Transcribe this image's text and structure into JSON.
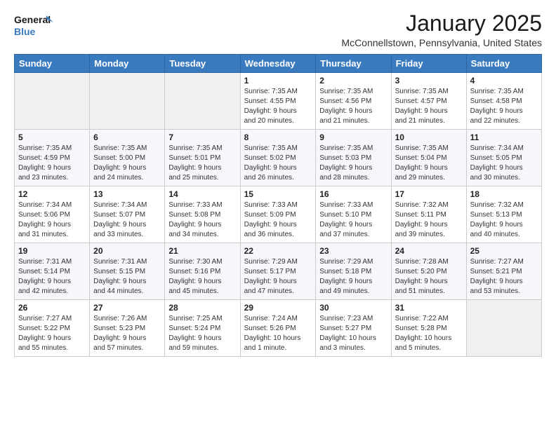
{
  "logo": {
    "line1": "General",
    "line2": "Blue"
  },
  "title": "January 2025",
  "location": "McConnellstown, Pennsylvania, United States",
  "headers": [
    "Sunday",
    "Monday",
    "Tuesday",
    "Wednesday",
    "Thursday",
    "Friday",
    "Saturday"
  ],
  "weeks": [
    [
      {
        "day": "",
        "info": ""
      },
      {
        "day": "",
        "info": ""
      },
      {
        "day": "",
        "info": ""
      },
      {
        "day": "1",
        "info": "Sunrise: 7:35 AM\nSunset: 4:55 PM\nDaylight: 9 hours\nand 20 minutes."
      },
      {
        "day": "2",
        "info": "Sunrise: 7:35 AM\nSunset: 4:56 PM\nDaylight: 9 hours\nand 21 minutes."
      },
      {
        "day": "3",
        "info": "Sunrise: 7:35 AM\nSunset: 4:57 PM\nDaylight: 9 hours\nand 21 minutes."
      },
      {
        "day": "4",
        "info": "Sunrise: 7:35 AM\nSunset: 4:58 PM\nDaylight: 9 hours\nand 22 minutes."
      }
    ],
    [
      {
        "day": "5",
        "info": "Sunrise: 7:35 AM\nSunset: 4:59 PM\nDaylight: 9 hours\nand 23 minutes."
      },
      {
        "day": "6",
        "info": "Sunrise: 7:35 AM\nSunset: 5:00 PM\nDaylight: 9 hours\nand 24 minutes."
      },
      {
        "day": "7",
        "info": "Sunrise: 7:35 AM\nSunset: 5:01 PM\nDaylight: 9 hours\nand 25 minutes."
      },
      {
        "day": "8",
        "info": "Sunrise: 7:35 AM\nSunset: 5:02 PM\nDaylight: 9 hours\nand 26 minutes."
      },
      {
        "day": "9",
        "info": "Sunrise: 7:35 AM\nSunset: 5:03 PM\nDaylight: 9 hours\nand 28 minutes."
      },
      {
        "day": "10",
        "info": "Sunrise: 7:35 AM\nSunset: 5:04 PM\nDaylight: 9 hours\nand 29 minutes."
      },
      {
        "day": "11",
        "info": "Sunrise: 7:34 AM\nSunset: 5:05 PM\nDaylight: 9 hours\nand 30 minutes."
      }
    ],
    [
      {
        "day": "12",
        "info": "Sunrise: 7:34 AM\nSunset: 5:06 PM\nDaylight: 9 hours\nand 31 minutes."
      },
      {
        "day": "13",
        "info": "Sunrise: 7:34 AM\nSunset: 5:07 PM\nDaylight: 9 hours\nand 33 minutes."
      },
      {
        "day": "14",
        "info": "Sunrise: 7:33 AM\nSunset: 5:08 PM\nDaylight: 9 hours\nand 34 minutes."
      },
      {
        "day": "15",
        "info": "Sunrise: 7:33 AM\nSunset: 5:09 PM\nDaylight: 9 hours\nand 36 minutes."
      },
      {
        "day": "16",
        "info": "Sunrise: 7:33 AM\nSunset: 5:10 PM\nDaylight: 9 hours\nand 37 minutes."
      },
      {
        "day": "17",
        "info": "Sunrise: 7:32 AM\nSunset: 5:11 PM\nDaylight: 9 hours\nand 39 minutes."
      },
      {
        "day": "18",
        "info": "Sunrise: 7:32 AM\nSunset: 5:13 PM\nDaylight: 9 hours\nand 40 minutes."
      }
    ],
    [
      {
        "day": "19",
        "info": "Sunrise: 7:31 AM\nSunset: 5:14 PM\nDaylight: 9 hours\nand 42 minutes."
      },
      {
        "day": "20",
        "info": "Sunrise: 7:31 AM\nSunset: 5:15 PM\nDaylight: 9 hours\nand 44 minutes."
      },
      {
        "day": "21",
        "info": "Sunrise: 7:30 AM\nSunset: 5:16 PM\nDaylight: 9 hours\nand 45 minutes."
      },
      {
        "day": "22",
        "info": "Sunrise: 7:29 AM\nSunset: 5:17 PM\nDaylight: 9 hours\nand 47 minutes."
      },
      {
        "day": "23",
        "info": "Sunrise: 7:29 AM\nSunset: 5:18 PM\nDaylight: 9 hours\nand 49 minutes."
      },
      {
        "day": "24",
        "info": "Sunrise: 7:28 AM\nSunset: 5:20 PM\nDaylight: 9 hours\nand 51 minutes."
      },
      {
        "day": "25",
        "info": "Sunrise: 7:27 AM\nSunset: 5:21 PM\nDaylight: 9 hours\nand 53 minutes."
      }
    ],
    [
      {
        "day": "26",
        "info": "Sunrise: 7:27 AM\nSunset: 5:22 PM\nDaylight: 9 hours\nand 55 minutes."
      },
      {
        "day": "27",
        "info": "Sunrise: 7:26 AM\nSunset: 5:23 PM\nDaylight: 9 hours\nand 57 minutes."
      },
      {
        "day": "28",
        "info": "Sunrise: 7:25 AM\nSunset: 5:24 PM\nDaylight: 9 hours\nand 59 minutes."
      },
      {
        "day": "29",
        "info": "Sunrise: 7:24 AM\nSunset: 5:26 PM\nDaylight: 10 hours\nand 1 minute."
      },
      {
        "day": "30",
        "info": "Sunrise: 7:23 AM\nSunset: 5:27 PM\nDaylight: 10 hours\nand 3 minutes."
      },
      {
        "day": "31",
        "info": "Sunrise: 7:22 AM\nSunset: 5:28 PM\nDaylight: 10 hours\nand 5 minutes."
      },
      {
        "day": "",
        "info": ""
      }
    ]
  ]
}
